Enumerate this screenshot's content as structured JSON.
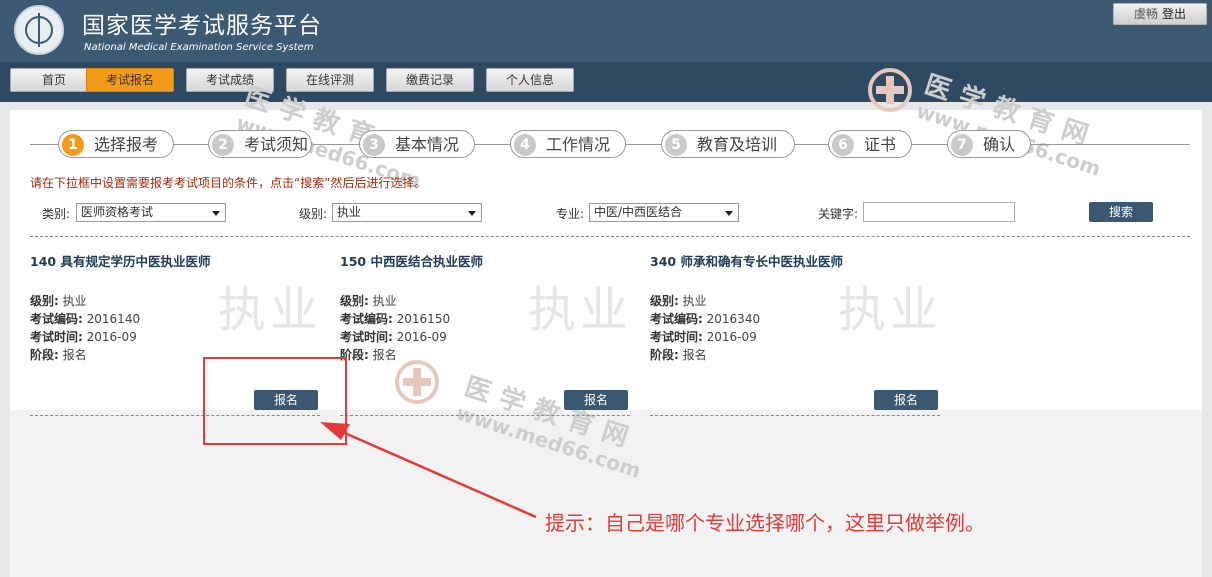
{
  "header": {
    "title": "国家医学考试服务平台",
    "subtitle": "National Medical Examination Service System",
    "user": "虞畅",
    "logout": "登出"
  },
  "nav": [
    {
      "label": "首页",
      "active": false
    },
    {
      "label": "考试报名",
      "active": true
    },
    {
      "label": "考试成绩",
      "active": false
    },
    {
      "label": "在线评测",
      "active": false
    },
    {
      "label": "缴费记录",
      "active": false
    },
    {
      "label": "个人信息",
      "active": false
    }
  ],
  "steps": [
    {
      "num": "1",
      "label": "选择报考",
      "active": true
    },
    {
      "num": "2",
      "label": "考试须知",
      "active": false
    },
    {
      "num": "3",
      "label": "基本情况",
      "active": false
    },
    {
      "num": "4",
      "label": "工作情况",
      "active": false
    },
    {
      "num": "5",
      "label": "教育及培训",
      "active": false
    },
    {
      "num": "6",
      "label": "证书",
      "active": false
    },
    {
      "num": "7",
      "label": "确认",
      "active": false
    }
  ],
  "tip": "请在下拉框中设置需要报考考试项目的条件，点击“搜索”然后后进行选择。",
  "filters": {
    "category_label": "类别:",
    "category_value": "医师资格考试",
    "level_label": "级别:",
    "level_value": "执业",
    "major_label": "专业:",
    "major_value": "中医/中西医结合",
    "keyword_label": "关键字:",
    "keyword_value": "",
    "search_button": "搜索"
  },
  "field_labels": {
    "level": "级别:",
    "code": "考试编码:",
    "time": "考试时间:",
    "stage": "阶段:"
  },
  "cards": [
    {
      "title": "140 具有规定学历中医执业医师",
      "level": "执业",
      "code": "2016140",
      "time": "2016-09",
      "stage": "报名",
      "watermark": "执业",
      "button": "报名"
    },
    {
      "title": "150 中西医结合执业医师",
      "level": "执业",
      "code": "2016150",
      "time": "2016-09",
      "stage": "报名",
      "watermark": "执业",
      "button": "报名"
    },
    {
      "title": "340 师承和确有专长中医执业医师",
      "level": "执业",
      "code": "2016340",
      "time": "2016-09",
      "stage": "报名",
      "watermark": "执业",
      "button": "报名"
    }
  ],
  "watermark": {
    "cn": "医学教育网",
    "en": "www.med66.com"
  },
  "annotation": "提示：自己是哪个专业选择哪个，这里只做举例。",
  "colors": {
    "header": "#3d5a74",
    "nav": "#2e4a63",
    "accent": "#f49a19",
    "button": "#3b5873",
    "annotation": "#e63a3a"
  }
}
